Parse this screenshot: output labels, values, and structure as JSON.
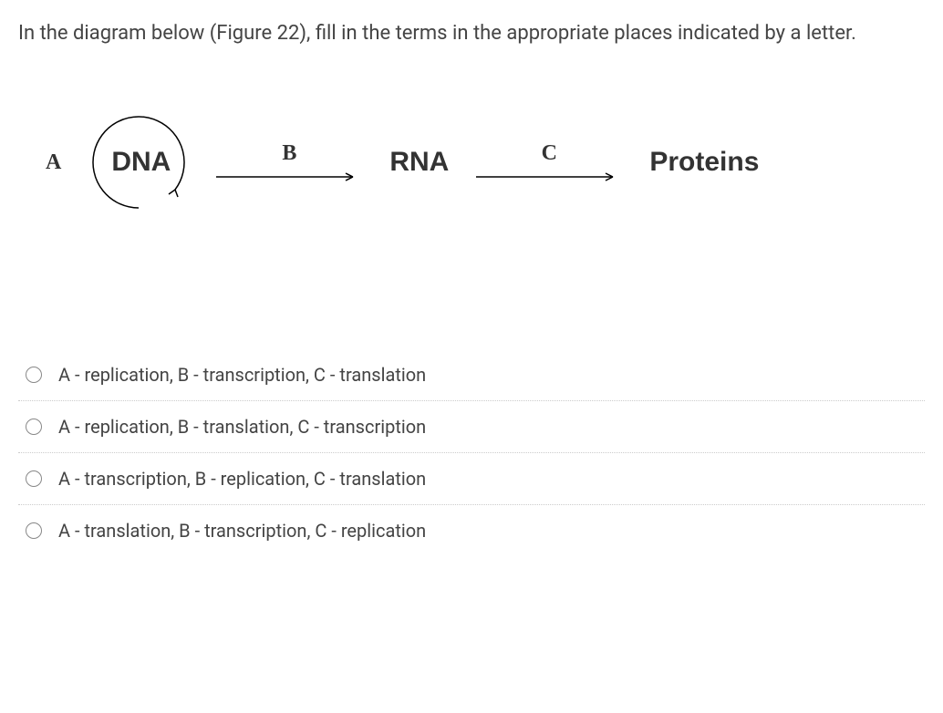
{
  "question": "In the diagram below (Figure 22),  fill in the terms in the appropriate places indicated by a letter.",
  "diagram": {
    "label_a": "A",
    "node_dna": "DNA",
    "label_b": "B",
    "node_rna": "RNA",
    "label_c": "C",
    "node_proteins": "Proteins"
  },
  "options": [
    {
      "text": "A - replication, B - transcription, C - translation"
    },
    {
      "text": "A - replication, B - translation, C - transcription"
    },
    {
      "text": "A - transcription, B - replication, C - translation"
    },
    {
      "text": "A - translation, B - transcription, C - replication"
    }
  ]
}
